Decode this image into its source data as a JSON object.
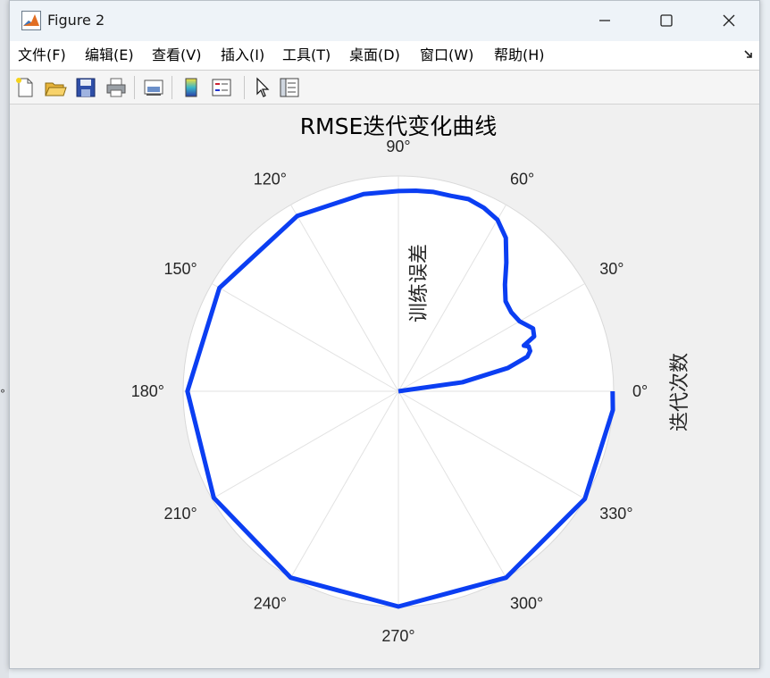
{
  "window": {
    "title": "Figure 2"
  },
  "menu": {
    "items": [
      "文件(F)",
      "编辑(E)",
      "查看(V)",
      "插入(I)",
      "工具(T)",
      "桌面(D)",
      "窗口(W)",
      "帮助(H)"
    ]
  },
  "toolbar": {
    "icons": [
      "new-figure-icon",
      "open-file-icon",
      "save-icon",
      "print-icon",
      "link-plot-icon",
      "insert-colorbar-icon",
      "insert-legend-icon",
      "edit-plot-arrow-icon",
      "property-inspector-icon"
    ]
  },
  "background": {
    "edge_glyph": "°"
  },
  "plot": {
    "title": "RMSE迭代变化曲线",
    "rlabel": "训练误差",
    "thetalabel": "迭代次数",
    "line_color": "#0b3ef2"
  },
  "chart_data": {
    "type": "polar-line",
    "title": "RMSE迭代变化曲线",
    "theta_axis_label": "迭代次数",
    "r_axis_label": "训练误差",
    "theta_ticks": [
      "0°",
      "30°",
      "60°",
      "90°",
      "120°",
      "150°",
      "180°",
      "210°",
      "240°",
      "270°",
      "300°",
      "330°"
    ],
    "rlim": [
      0,
      1
    ],
    "r_tick_labels_shown": false,
    "grid": true,
    "series": [
      {
        "theta_deg": [
          0,
          8,
          12,
          15,
          17,
          19,
          20,
          22,
          25,
          30,
          35,
          40,
          45,
          50,
          55,
          60,
          65,
          70,
          75,
          80,
          85,
          90,
          100,
          120,
          150,
          180,
          210,
          240,
          270,
          300,
          330,
          355,
          360
        ],
        "r": [
          0.0,
          0.3,
          0.52,
          0.62,
          0.64,
          0.64,
          0.62,
          0.68,
          0.69,
          0.65,
          0.64,
          0.65,
          0.7,
          0.78,
          0.87,
          0.92,
          0.94,
          0.95,
          0.94,
          0.94,
          0.935,
          0.93,
          0.93,
          0.94,
          0.96,
          0.98,
          0.99,
          1.0,
          1.0,
          1.0,
          1.0,
          1.0,
          0.995
        ]
      }
    ]
  }
}
